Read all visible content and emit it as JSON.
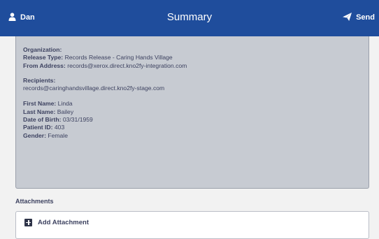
{
  "header": {
    "user_label": "Dan",
    "title": "Summary",
    "send_label": "Send",
    "user_icon": "user-icon",
    "send_icon": "paper-plane-icon",
    "bar_color": "#1f4d9c"
  },
  "summary": {
    "organization_label": "Organization:",
    "organization_value": "",
    "release_type_label": "Release Type:",
    "release_type_value": "Records Release - Caring Hands Village",
    "from_address_label": "From Address:",
    "from_address_value": "records@xerox.direct.kno2fy-integration.com",
    "recipients_label": "Recipients:",
    "recipients_value": "records@caringhandsvillage.direct.kno2fy-stage.com",
    "first_name_label": "First Name:",
    "first_name_value": "Linda",
    "last_name_label": "Last Name:",
    "last_name_value": "Bailey",
    "dob_label": "Date of Birth:",
    "dob_value": "03/31/1959",
    "patient_id_label": "Patient ID:",
    "patient_id_value": "403",
    "gender_label": "Gender:",
    "gender_value": "Female"
  },
  "attachments": {
    "heading": "Attachments",
    "add_label": "Add Attachment",
    "add_icon": "plus-square-icon"
  }
}
